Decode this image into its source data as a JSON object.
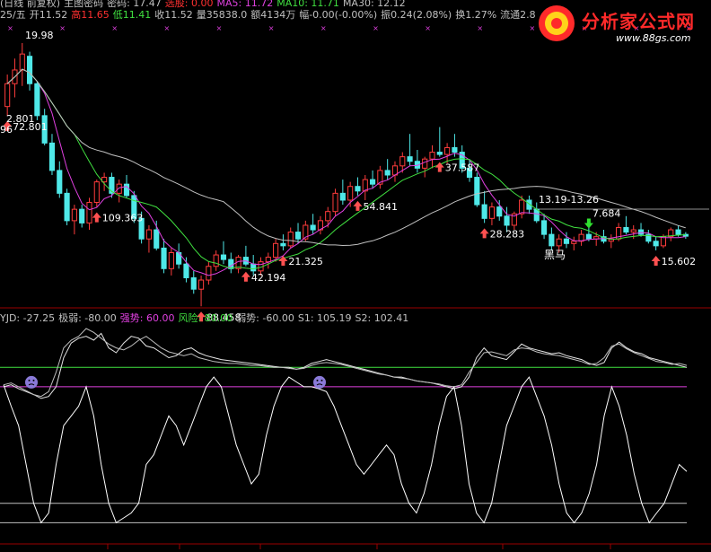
{
  "header": {
    "line1": [
      {
        "text": "(日线 前复权)",
        "color": "#c0c0c0"
      },
      {
        "text": "主图密码",
        "color": "#c0c0c0"
      },
      {
        "text": "密码: 17.47",
        "color": "#c0c0c0"
      },
      {
        "text": "选股: 0.00",
        "color": "#ff3030"
      },
      {
        "text": "MA5: 11.72",
        "color": "#e040e0"
      },
      {
        "text": "MA10: 11.71",
        "color": "#40e040"
      },
      {
        "text": "MA30: 12.12",
        "color": "#c0c0c0"
      }
    ],
    "line2": [
      {
        "text": "25/五",
        "color": "#c0c0c0"
      },
      {
        "text": "开11.52",
        "color": "#c0c0c0"
      },
      {
        "text": "高11.65",
        "color": "#ff3030"
      },
      {
        "text": "低11.41",
        "color": "#40e040"
      },
      {
        "text": "收11.52",
        "color": "#c0c0c0"
      },
      {
        "text": "量35838.0",
        "color": "#c0c0c0"
      },
      {
        "text": "额4134万",
        "color": "#c0c0c0"
      },
      {
        "text": "幅-0.00(-0.00%)",
        "color": "#c0c0c0"
      },
      {
        "text": "振0.24(2.08%)",
        "color": "#c0c0c0"
      },
      {
        "text": "换1.27%",
        "color": "#c0c0c0"
      },
      {
        "text": "流通2.8",
        "color": "#c0c0c0"
      }
    ]
  },
  "indicator_header": [
    {
      "text": "YJD: -27.25",
      "color": "#c0c0c0"
    },
    {
      "text": "极弱: -80.00",
      "color": "#c0c0c0"
    },
    {
      "text": "强势: 60.00",
      "color": "#e040e0"
    },
    {
      "text": "风险: 80.00",
      "color": "#40e040"
    },
    {
      "text": "弱势: -60.00",
      "color": "#c0c0c0"
    },
    {
      "text": "S1: 105.19",
      "color": "#c0c0c0"
    },
    {
      "text": "S2: 102.41",
      "color": "#c0c0c0"
    }
  ],
  "logo": {
    "name": "分析家公式网",
    "url": "www.88gs.com"
  },
  "annotations": {
    "high_label": "19.98",
    "range_label": "13.19-13.26",
    "black_horse": "黑马",
    "left_edge_a": "2.801",
    "left_edge_b": "96"
  },
  "chart_data": {
    "type": "candlestick",
    "price_axis_range": [
      8.5,
      21.0
    ],
    "candles": [
      [
        17.2,
        18.6,
        16.8,
        18.2
      ],
      [
        18.2,
        19.3,
        17.6,
        18.8
      ],
      [
        18.8,
        19.98,
        18.1,
        19.5
      ],
      [
        19.4,
        19.6,
        17.9,
        18.2
      ],
      [
        18.2,
        18.3,
        16.6,
        16.8
      ],
      [
        16.8,
        17.1,
        15.5,
        15.6
      ],
      [
        15.6,
        16.0,
        14.2,
        14.4
      ],
      [
        14.4,
        14.8,
        13.2,
        13.4
      ],
      [
        13.4,
        13.6,
        12.0,
        12.2
      ],
      [
        12.2,
        12.9,
        11.6,
        12.7
      ],
      [
        12.7,
        12.9,
        11.9,
        12.1
      ],
      [
        12.1,
        13.2,
        11.8,
        13.0
      ],
      [
        13.0,
        14.0,
        12.8,
        13.9
      ],
      [
        13.9,
        14.3,
        13.5,
        14.1
      ],
      [
        14.1,
        14.3,
        13.2,
        13.4
      ],
      [
        13.4,
        14.0,
        13.0,
        13.8
      ],
      [
        13.8,
        14.2,
        13.2,
        13.3
      ],
      [
        13.3,
        13.5,
        12.1,
        12.3
      ],
      [
        12.3,
        12.6,
        11.2,
        11.4
      ],
      [
        11.4,
        12.0,
        10.8,
        11.8
      ],
      [
        11.8,
        12.2,
        10.9,
        11.0
      ],
      [
        11.0,
        11.4,
        9.9,
        10.1
      ],
      [
        10.1,
        11.0,
        9.8,
        10.8
      ],
      [
        10.8,
        11.2,
        10.1,
        10.3
      ],
      [
        10.3,
        10.6,
        9.5,
        9.7
      ],
      [
        9.7,
        10.0,
        9.0,
        9.2
      ],
      [
        9.2,
        9.8,
        8.45,
        9.6
      ],
      [
        9.6,
        10.4,
        9.4,
        10.2
      ],
      [
        10.2,
        10.9,
        10.0,
        10.7
      ],
      [
        10.7,
        11.3,
        10.3,
        10.5
      ],
      [
        10.5,
        10.8,
        9.9,
        10.1
      ],
      [
        10.1,
        10.7,
        9.9,
        10.6
      ],
      [
        10.6,
        11.1,
        10.2,
        10.3
      ],
      [
        10.3,
        10.7,
        9.8,
        10.0
      ],
      [
        10.0,
        10.6,
        9.8,
        10.4
      ],
      [
        10.4,
        10.8,
        10.1,
        10.6
      ],
      [
        10.6,
        11.4,
        10.4,
        11.2
      ],
      [
        11.2,
        11.6,
        10.9,
        11.1
      ],
      [
        11.1,
        11.9,
        11.0,
        11.7
      ],
      [
        11.7,
        12.1,
        11.2,
        11.4
      ],
      [
        11.4,
        12.2,
        11.3,
        12.0
      ],
      [
        12.0,
        12.5,
        11.6,
        11.8
      ],
      [
        11.8,
        12.4,
        11.6,
        12.2
      ],
      [
        12.2,
        12.8,
        11.9,
        12.6
      ],
      [
        12.6,
        13.6,
        12.4,
        13.4
      ],
      [
        13.4,
        14.0,
        12.9,
        13.1
      ],
      [
        13.1,
        13.9,
        12.8,
        13.7
      ],
      [
        13.7,
        14.1,
        13.3,
        13.5
      ],
      [
        13.5,
        14.2,
        13.1,
        14.0
      ],
      [
        14.0,
        14.4,
        13.6,
        13.8
      ],
      [
        13.8,
        14.6,
        13.6,
        14.4
      ],
      [
        14.4,
        14.9,
        14.0,
        14.2
      ],
      [
        14.2,
        14.8,
        13.9,
        14.6
      ],
      [
        14.6,
        15.2,
        14.3,
        15.0
      ],
      [
        15.0,
        16.0,
        14.6,
        14.8
      ],
      [
        14.8,
        15.3,
        14.3,
        14.5
      ],
      [
        14.5,
        15.0,
        14.1,
        14.9
      ],
      [
        14.9,
        15.5,
        14.5,
        15.2
      ],
      [
        15.2,
        16.3,
        15.0,
        15.1
      ],
      [
        15.1,
        15.6,
        14.7,
        15.4
      ],
      [
        15.4,
        16.0,
        15.0,
        15.2
      ],
      [
        15.2,
        15.5,
        14.3,
        14.5
      ],
      [
        14.5,
        14.9,
        13.9,
        14.1
      ],
      [
        14.1,
        14.3,
        12.8,
        12.9
      ],
      [
        12.9,
        13.5,
        12.1,
        12.3
      ],
      [
        12.3,
        13.0,
        12.0,
        12.8
      ],
      [
        12.8,
        13.1,
        12.2,
        12.4
      ],
      [
        12.4,
        12.8,
        11.7,
        12.0
      ],
      [
        12.0,
        12.6,
        11.8,
        12.5
      ],
      [
        12.5,
        13.3,
        12.3,
        13.1
      ],
      [
        13.1,
        13.3,
        12.5,
        12.7
      ],
      [
        12.7,
        13.0,
        12.1,
        12.2
      ],
      [
        12.2,
        12.5,
        11.4,
        11.6
      ],
      [
        11.6,
        11.9,
        10.9,
        11.1
      ],
      [
        11.1,
        11.6,
        10.8,
        11.4
      ],
      [
        11.4,
        11.7,
        11.0,
        11.2
      ],
      [
        11.2,
        11.5,
        10.9,
        11.3
      ],
      [
        11.3,
        11.8,
        11.1,
        11.6
      ],
      [
        11.6,
        11.9,
        11.3,
        11.4
      ],
      [
        11.4,
        11.7,
        11.1,
        11.5
      ],
      [
        11.5,
        11.8,
        11.2,
        11.3
      ],
      [
        11.3,
        11.6,
        11.0,
        11.4
      ],
      [
        11.4,
        12.1,
        11.3,
        11.9
      ],
      [
        11.9,
        12.4,
        11.6,
        11.7
      ],
      [
        11.7,
        12.0,
        11.4,
        11.8
      ],
      [
        11.8,
        12.1,
        11.5,
        11.6
      ],
      [
        11.6,
        11.8,
        11.2,
        11.3
      ],
      [
        11.3,
        11.5,
        10.9,
        11.1
      ],
      [
        11.1,
        11.6,
        11.0,
        11.5
      ],
      [
        11.5,
        11.9,
        11.3,
        11.8
      ],
      [
        11.8,
        12.0,
        11.5,
        11.6
      ],
      [
        11.6,
        11.7,
        11.41,
        11.52
      ]
    ],
    "ma_series": [
      {
        "name": "MA5",
        "color": "#e040e0",
        "period": 5
      },
      {
        "name": "MA10",
        "color": "#40e040",
        "period": 10
      },
      {
        "name": "MA30",
        "color": "#c0c0c0",
        "period": 30
      }
    ],
    "buy_signals": [
      {
        "index": 0,
        "label": "72.801"
      },
      {
        "index": 12,
        "label": "109.363"
      },
      {
        "index": 26,
        "label": "88.458"
      },
      {
        "index": 32,
        "label": "42.194"
      },
      {
        "index": 37,
        "label": "21.325"
      },
      {
        "index": 47,
        "label": "54.841"
      },
      {
        "index": 58,
        "label": "37.587"
      },
      {
        "index": 64,
        "label": "28.283"
      },
      {
        "index": 87,
        "label": "15.602"
      }
    ],
    "sell_signals": [
      {
        "index": 78,
        "label": "7.684"
      }
    ],
    "indicator": {
      "range": [
        -100,
        120
      ],
      "levels": [
        {
          "name": "风险",
          "value": 80,
          "color": "#40e040"
        },
        {
          "name": "强势",
          "value": 60,
          "color": "#e040e0"
        },
        {
          "name": "弱势",
          "value": -60,
          "color": "#c0c0c0"
        },
        {
          "name": "极弱",
          "value": -80,
          "color": "#c0c0c0"
        }
      ],
      "S1": [
        60,
        62,
        58,
        55,
        52,
        48,
        50,
        60,
        90,
        105,
        110,
        112,
        108,
        115,
        100,
        95,
        105,
        112,
        110,
        102,
        100,
        95,
        90,
        92,
        98,
        100,
        95,
        92,
        90,
        88,
        87,
        86,
        85,
        84,
        83,
        82,
        81,
        80,
        80,
        78,
        80,
        84,
        86,
        88,
        86,
        84,
        82,
        80,
        78,
        76,
        74,
        72,
        70,
        70,
        68,
        66,
        65,
        64,
        62,
        60,
        58,
        60,
        70,
        90,
        100,
        92,
        90,
        88,
        96,
        104,
        100,
        98,
        96,
        94,
        95,
        92,
        90,
        88,
        84,
        82,
        85,
        100,
        106,
        100,
        96,
        94,
        90,
        88,
        86,
        84,
        82,
        80
      ],
      "S2": [
        62,
        64,
        60,
        56,
        52,
        50,
        55,
        75,
        100,
        108,
        112,
        120,
        116,
        110,
        104,
        100,
        98,
        102,
        108,
        112,
        106,
        100,
        96,
        94,
        92,
        94,
        90,
        88,
        86,
        85,
        84,
        84,
        83,
        82,
        82,
        81,
        80,
        80,
        79,
        78,
        79,
        82,
        84,
        85,
        84,
        83,
        81,
        79,
        77,
        75,
        73,
        72,
        70,
        69,
        68,
        66,
        65,
        64,
        63,
        61,
        60,
        62,
        75,
        85,
        95,
        96,
        94,
        92,
        98,
        100,
        99,
        96,
        94,
        93,
        92,
        90,
        88,
        86,
        83,
        84,
        90,
        102,
        104,
        99,
        95,
        92,
        89,
        86,
        85,
        83,
        84,
        82
      ],
      "YJD": [
        62,
        40,
        20,
        -20,
        -60,
        -80,
        -70,
        -20,
        20,
        30,
        40,
        60,
        30,
        -20,
        -60,
        -80,
        -75,
        -70,
        -60,
        -20,
        -10,
        10,
        30,
        20,
        0,
        20,
        40,
        60,
        70,
        60,
        30,
        0,
        -20,
        -40,
        -30,
        10,
        40,
        60,
        70,
        65,
        60,
        60,
        58,
        55,
        40,
        20,
        0,
        -20,
        -30,
        -20,
        -10,
        0,
        -10,
        -40,
        -60,
        -70,
        -50,
        -20,
        20,
        50,
        60,
        20,
        -40,
        -70,
        -80,
        -60,
        -20,
        20,
        40,
        60,
        70,
        50,
        30,
        0,
        -40,
        -70,
        -80,
        -70,
        -50,
        -20,
        30,
        60,
        40,
        10,
        -30,
        -60,
        -80,
        -70,
        -60,
        -40,
        -20,
        -27.25
      ]
    }
  }
}
